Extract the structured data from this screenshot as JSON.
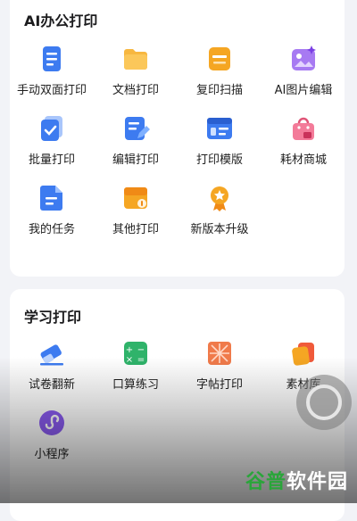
{
  "office": {
    "title": "AI办公打印",
    "items": [
      {
        "label": "手动双面打印",
        "icon": "manual-duplex-icon"
      },
      {
        "label": "文档打印",
        "icon": "folder-icon"
      },
      {
        "label": "复印扫描",
        "icon": "copy-scan-icon"
      },
      {
        "label": "AI图片编辑",
        "icon": "ai-image-edit-icon"
      },
      {
        "label": "批量打印",
        "icon": "batch-print-icon"
      },
      {
        "label": "编辑打印",
        "icon": "edit-print-icon"
      },
      {
        "label": "打印模版",
        "icon": "print-template-icon"
      },
      {
        "label": "耗材商城",
        "icon": "shopping-bag-icon"
      },
      {
        "label": "我的任务",
        "icon": "task-document-icon"
      },
      {
        "label": "其他打印",
        "icon": "other-print-icon"
      },
      {
        "label": "新版本升级",
        "icon": "upgrade-medal-icon"
      }
    ]
  },
  "study": {
    "title": "学习打印",
    "items": [
      {
        "label": "试卷翻新",
        "icon": "eraser-icon"
      },
      {
        "label": "口算练习",
        "icon": "calculator-icon"
      },
      {
        "label": "字帖打印",
        "icon": "copybook-icon"
      },
      {
        "label": "素材库",
        "icon": "material-library-icon"
      },
      {
        "label": "小程序",
        "icon": "mini-program-icon"
      }
    ]
  },
  "watermark": {
    "part_a": "谷普",
    "part_b": "软件园"
  },
  "colors": {
    "blue": "#3d7bf0",
    "orange": "#f5a623",
    "purple": "#9b6cf0",
    "pink": "#f06a8a",
    "green": "#2fb36a",
    "red": "#f05a3a"
  }
}
